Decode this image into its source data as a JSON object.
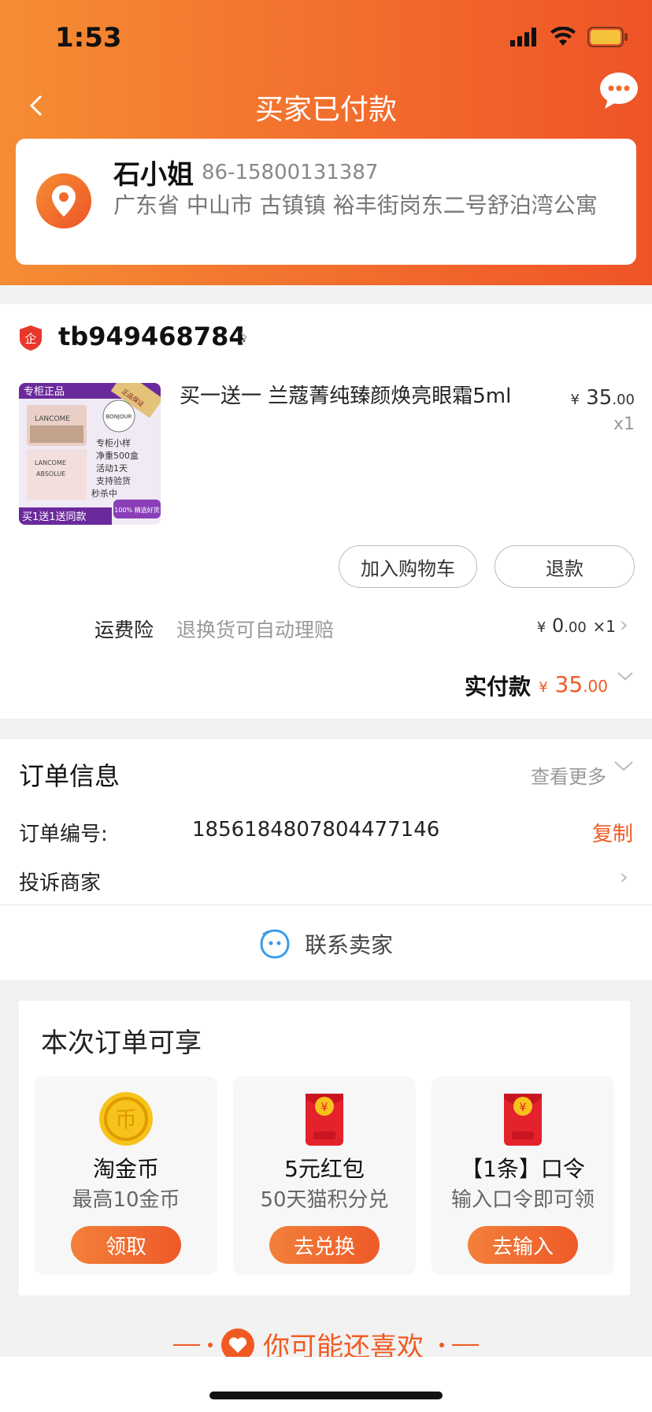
{
  "status": {
    "time": "1:53"
  },
  "nav": {
    "title": "买家已付款"
  },
  "address": {
    "name": "石小姐",
    "phone": "86-15800131387",
    "detail": "广东省 中山市 古镇镇 裕丰街岗东二号舒泊湾公寓"
  },
  "shop": {
    "name": "tb949468784"
  },
  "product": {
    "title": "买一送一 兰蔻菁纯臻颜焕亮眼霜5ml",
    "price_symbol": "¥",
    "price_int": "35",
    "price_dec": ".00",
    "qty": "x1",
    "image_texts": {
      "top_banner": "专柜正品",
      "bottom_banner": "买1送1送同款",
      "badge": "BONJOUR",
      "seal": "正品保证",
      "corner": "100% 精选好货",
      "brand": "LANCOME",
      "line": "ABSOLUE",
      "lines": [
        "专柜小样",
        "净重500盒",
        "活动1天",
        "支持验货",
        "秒杀中"
      ]
    }
  },
  "actions": {
    "add_cart": "加入购物车",
    "refund": "退款"
  },
  "insurance": {
    "label": "运费险",
    "desc": "退换货可自动理赔",
    "price_symbol": "¥",
    "price_int": "0",
    "price_dec": ".00",
    "qty": "×1"
  },
  "paid": {
    "label": "实付款",
    "symbol": "¥",
    "int": "35",
    "dec": ".00"
  },
  "order_info": {
    "title": "订单信息",
    "more": "查看更多",
    "number_label": "订单编号:",
    "number": "1856184807804477146",
    "copy": "复制",
    "complain": "投诉商家",
    "contact": "联系卖家"
  },
  "benefits": {
    "title": "本次订单可享",
    "items": [
      {
        "name": "淘金币",
        "sub": "最高10金币",
        "button": "领取",
        "icon": "coin-icon",
        "glyph": "币"
      },
      {
        "name": "5元红包",
        "sub": "50天猫积分兑",
        "button": "去兑换",
        "icon": "red-envelope-icon",
        "glyph": "¥"
      },
      {
        "name": "【1条】口令",
        "sub": "输入口令即可领",
        "button": "去输入",
        "icon": "red-envelope-icon",
        "glyph": "¥"
      }
    ]
  },
  "recommend": {
    "title": "你可能还喜欢"
  },
  "colors": {
    "accent": "#f05a22",
    "header_start": "#f58d34",
    "header_end": "#ee5427"
  }
}
